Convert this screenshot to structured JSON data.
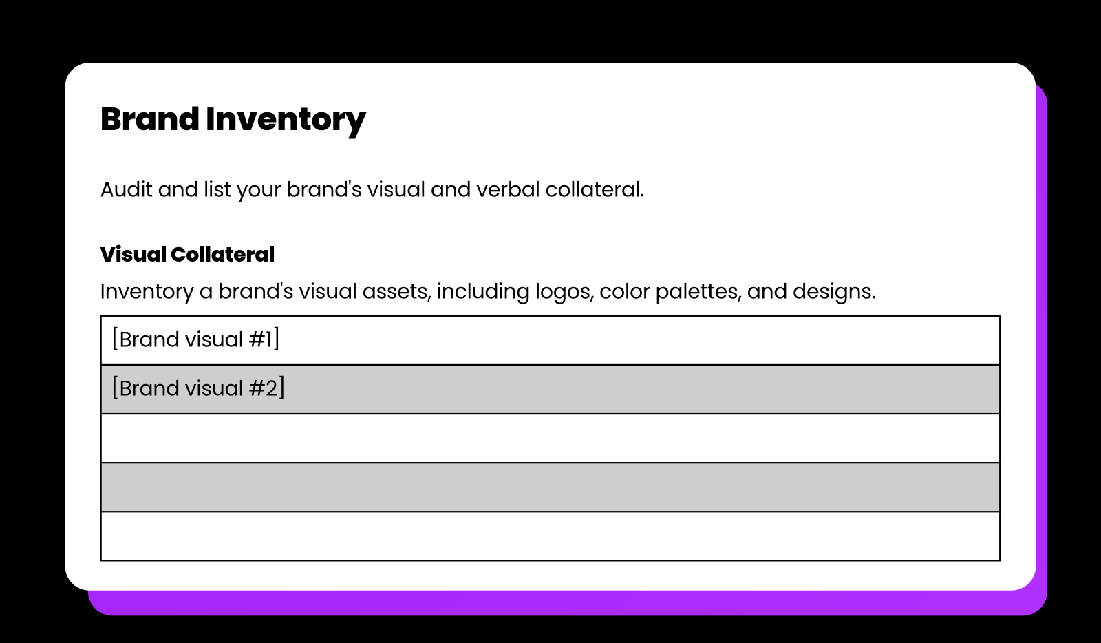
{
  "title": "Brand Inventory",
  "description": "Audit and list your brand's visual and verbal collateral.",
  "section": {
    "title": "Visual Collateral",
    "description": "Inventory a brand's visual assets, including logos, color palettes, and designs.",
    "rows": [
      {
        "value": "[Brand visual #1]"
      },
      {
        "value": "[Brand visual #2]"
      },
      {
        "value": ""
      },
      {
        "value": ""
      },
      {
        "value": ""
      }
    ]
  }
}
